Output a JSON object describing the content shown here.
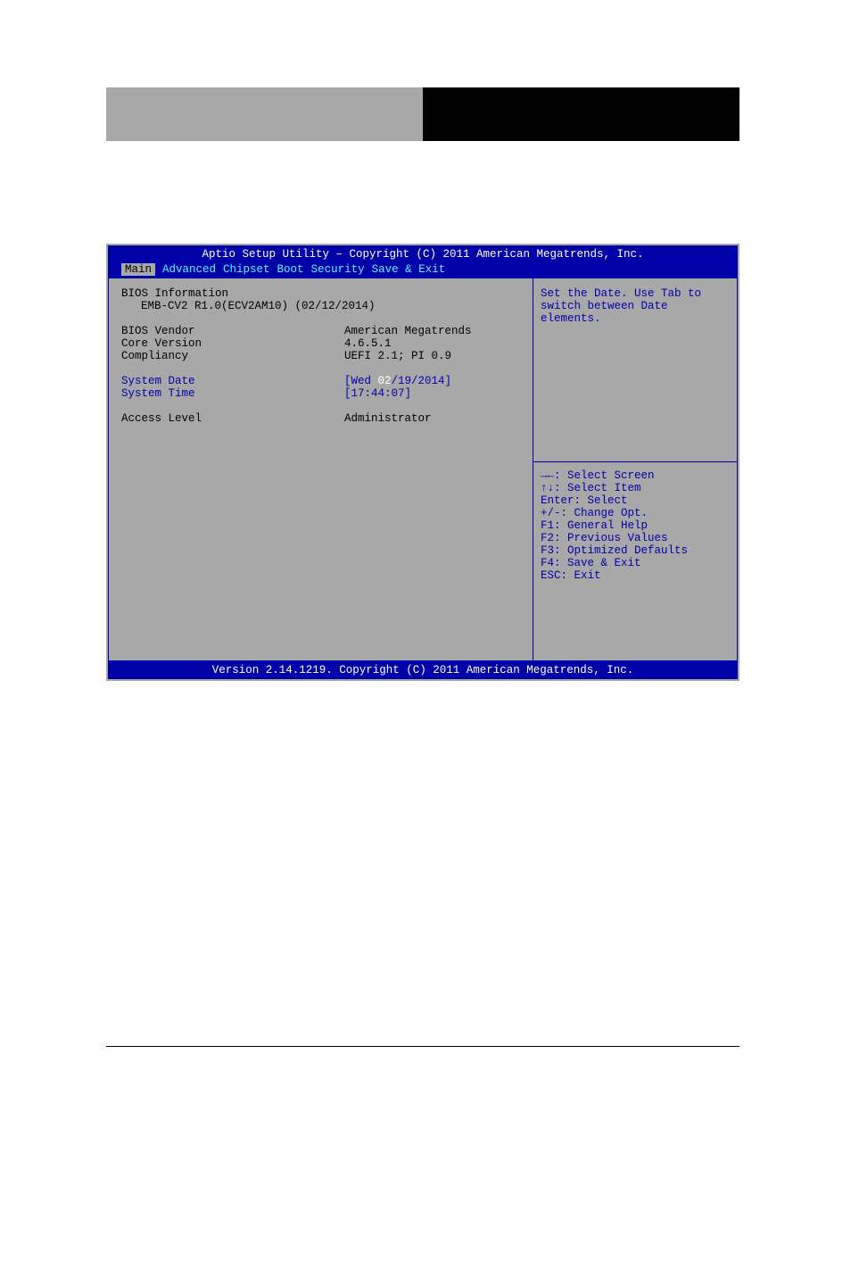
{
  "bios": {
    "title": "Aptio Setup Utility – Copyright (C) 2011 American Megatrends, Inc.",
    "tabs": {
      "main": "Main",
      "advanced": "Advanced",
      "chipset": "Chipset",
      "boot": "Boot",
      "security": "Security",
      "saveexit": "Save & Exit"
    },
    "info": {
      "heading": "BIOS Information",
      "board": "EMB-CV2 R1.0(ECV2AM10) (02/12/2014)",
      "vendor_label": "BIOS Vendor",
      "vendor_value": "American Megatrends",
      "core_label": "Core Version",
      "core_value": "4.6.5.1",
      "compliancy_label": "Compliancy",
      "compliancy_value": "UEFI 2.1; PI 0.9",
      "date_label": "System Date",
      "date_value_p1": "[Wed ",
      "date_value_p2": "02",
      "date_value_p3": "/19/2014]",
      "time_label": "System Time",
      "time_value": "[17:44:07]",
      "access_label": "Access Level",
      "access_value": "Administrator"
    },
    "help": {
      "text": "Set the Date. Use Tab to switch between Date elements.",
      "nav1": "→←: Select Screen",
      "nav2": "↑↓: Select Item",
      "nav3": "Enter: Select",
      "nav4": "+/-: Change Opt.",
      "nav5": "F1: General Help",
      "nav6": "F2: Previous Values",
      "nav7": "F3: Optimized Defaults",
      "nav8": "F4: Save & Exit",
      "nav9": "ESC: Exit"
    },
    "footer": "Version 2.14.1219. Copyright (C) 2011 American Megatrends, Inc."
  }
}
